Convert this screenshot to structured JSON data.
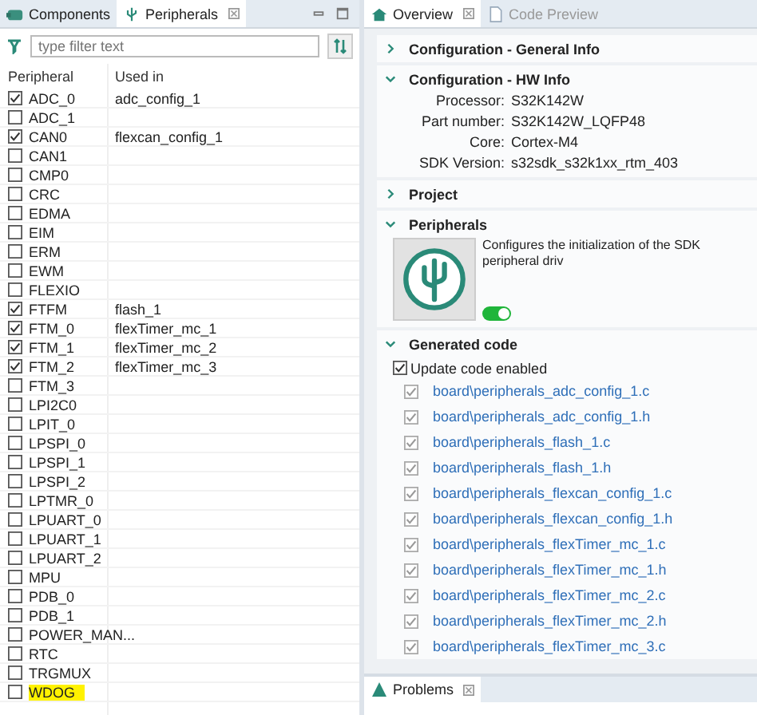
{
  "left_tabs": [
    {
      "label": "Components",
      "selected": false
    },
    {
      "label": "Peripherals",
      "selected": true
    }
  ],
  "filter": {
    "placeholder": "type filter text"
  },
  "table": {
    "columns": [
      "Peripheral",
      "Used in"
    ],
    "rows": [
      {
        "name": "ADC_0",
        "used_in": "adc_config_1",
        "checked": true,
        "highlighted": false
      },
      {
        "name": "ADC_1",
        "checked": false,
        "highlighted": false
      },
      {
        "name": "CAN0",
        "used_in": "flexcan_config_1",
        "checked": true,
        "highlighted": false
      },
      {
        "name": "CAN1",
        "checked": false,
        "highlighted": false
      },
      {
        "name": "CMP0",
        "checked": false,
        "highlighted": false
      },
      {
        "name": "CRC",
        "checked": false,
        "highlighted": false
      },
      {
        "name": "EDMA",
        "checked": false,
        "highlighted": false
      },
      {
        "name": "EIM",
        "checked": false,
        "highlighted": false
      },
      {
        "name": "ERM",
        "checked": false,
        "highlighted": false
      },
      {
        "name": "EWM",
        "checked": false,
        "highlighted": false
      },
      {
        "name": "FLEXIO",
        "checked": false,
        "highlighted": false
      },
      {
        "name": "FTFM",
        "used_in": "flash_1",
        "checked": true,
        "highlighted": false
      },
      {
        "name": "FTM_0",
        "used_in": "flexTimer_mc_1",
        "checked": true,
        "highlighted": false
      },
      {
        "name": "FTM_1",
        "used_in": "flexTimer_mc_2",
        "checked": true,
        "highlighted": false
      },
      {
        "name": "FTM_2",
        "used_in": "flexTimer_mc_3",
        "checked": true,
        "highlighted": false
      },
      {
        "name": "FTM_3",
        "checked": false,
        "highlighted": false
      },
      {
        "name": "LPI2C0",
        "checked": false,
        "highlighted": false
      },
      {
        "name": "LPIT_0",
        "checked": false,
        "highlighted": false
      },
      {
        "name": "LPSPI_0",
        "checked": false,
        "highlighted": false
      },
      {
        "name": "LPSPI_1",
        "checked": false,
        "highlighted": false
      },
      {
        "name": "LPSPI_2",
        "checked": false,
        "highlighted": false
      },
      {
        "name": "LPTMR_0",
        "checked": false,
        "highlighted": false
      },
      {
        "name": "LPUART_0",
        "checked": false,
        "highlighted": false
      },
      {
        "name": "LPUART_1",
        "checked": false,
        "highlighted": false
      },
      {
        "name": "LPUART_2",
        "checked": false,
        "highlighted": false
      },
      {
        "name": "MPU",
        "checked": false,
        "highlighted": false
      },
      {
        "name": "PDB_0",
        "checked": false,
        "highlighted": false
      },
      {
        "name": "PDB_1",
        "checked": false,
        "highlighted": false
      },
      {
        "name": "POWER_MAN...",
        "checked": false,
        "highlighted": false
      },
      {
        "name": "RTC",
        "checked": false,
        "highlighted": false
      },
      {
        "name": "TRGMUX",
        "checked": false,
        "highlighted": false
      },
      {
        "name": "WDOG",
        "checked": false,
        "highlighted": true
      }
    ]
  },
  "right_tabs": [
    {
      "label": "Overview",
      "selected": true
    },
    {
      "label": "Code Preview",
      "selected": false
    }
  ],
  "sections": [
    {
      "title": "Configuration - General Info",
      "expanded": false
    },
    {
      "title": "Configuration - HW Info",
      "expanded": true,
      "fields": [
        {
          "label": "Processor:",
          "value": "S32K142W"
        },
        {
          "label": "Part number:",
          "value": "S32K142W_LQFP48"
        },
        {
          "label": "Core:",
          "value": "Cortex-M4"
        },
        {
          "label": "SDK Version:",
          "value": "s32sdk_s32k1xx_rtm_403"
        }
      ]
    },
    {
      "title": "Project",
      "expanded": false
    },
    {
      "title": "Peripherals",
      "expanded": true,
      "description": "Configures the initialization of the SDK peripheral driv",
      "enabled": true
    },
    {
      "title": "Generated code",
      "expanded": true,
      "update_label": "Update code enabled",
      "update_checked": true,
      "files": [
        {
          "name": "board\\peripherals_adc_config_1.c",
          "checked": true
        },
        {
          "name": "board\\peripherals_adc_config_1.h",
          "checked": true
        },
        {
          "name": "board\\peripherals_flash_1.c",
          "checked": true
        },
        {
          "name": "board\\peripherals_flash_1.h",
          "checked": true
        },
        {
          "name": "board\\peripherals_flexcan_config_1.c",
          "checked": true
        },
        {
          "name": "board\\peripherals_flexcan_config_1.h",
          "checked": true
        },
        {
          "name": "board\\peripherals_flexTimer_mc_1.c",
          "checked": true
        },
        {
          "name": "board\\peripherals_flexTimer_mc_1.h",
          "checked": true
        },
        {
          "name": "board\\peripherals_flexTimer_mc_2.c",
          "checked": true
        },
        {
          "name": "board\\peripherals_flexTimer_mc_2.h",
          "checked": true
        },
        {
          "name": "board\\peripherals_flexTimer_mc_3.c",
          "checked": true
        }
      ]
    }
  ],
  "bottom_tab": {
    "label": "Problems"
  }
}
